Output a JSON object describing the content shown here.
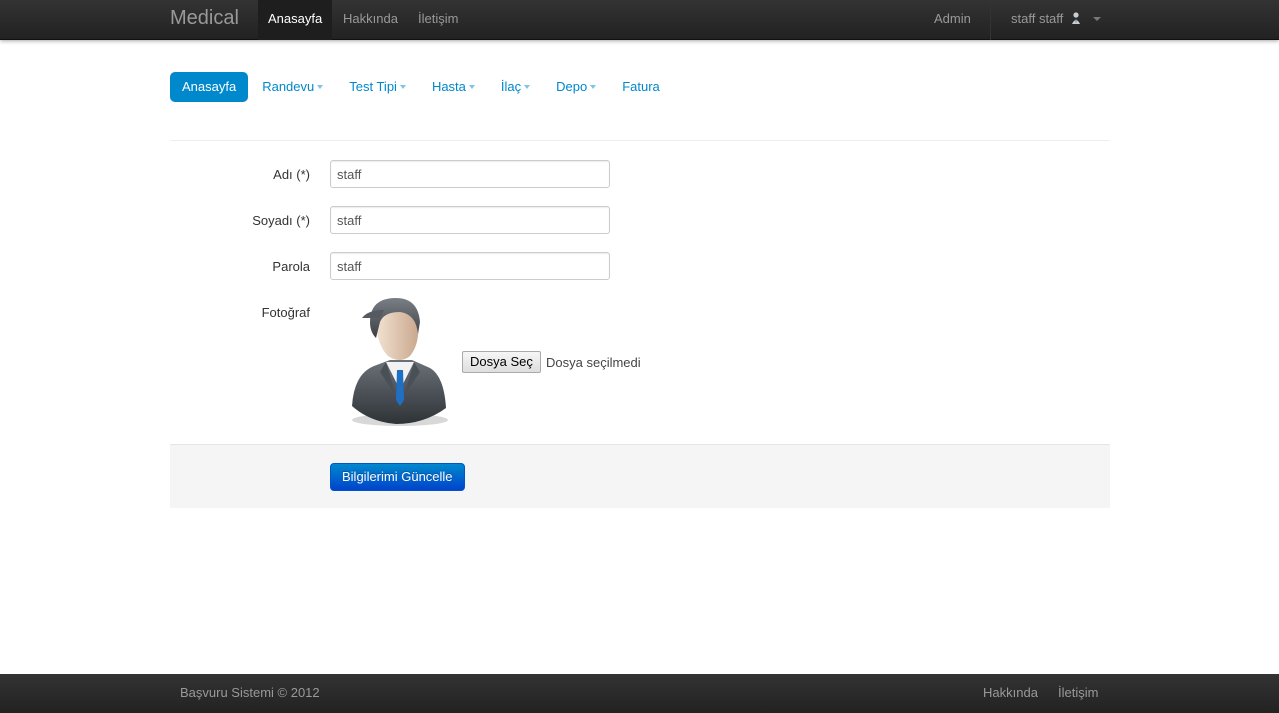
{
  "navbar": {
    "brand": "Medical",
    "links": [
      "Anasayfa",
      "Hakkında",
      "İletişim"
    ],
    "admin": "Admin",
    "user": "staff staff"
  },
  "pills": {
    "items": [
      "Anasayfa",
      "Randevu",
      "Test Tipi",
      "Hasta",
      "İlaç",
      "Depo",
      "Fatura"
    ]
  },
  "form": {
    "first_name_label": "Adı (*)",
    "first_name_value": "staff",
    "last_name_label": "Soyadı (*)",
    "last_name_value": "staff",
    "password_label": "Parola",
    "password_value": "staff",
    "photo_label": "Fotoğraf",
    "file_button": "Dosya Seç",
    "file_status": "Dosya seçilmedi",
    "submit": "Bilgilerimi Güncelle"
  },
  "footer": {
    "copyright": "Başvuru Sistemi © 2012",
    "links": [
      "Hakkında",
      "İletişim"
    ]
  },
  "colors": {
    "accent": "#0088cc",
    "navbar_bg": "#222222"
  }
}
